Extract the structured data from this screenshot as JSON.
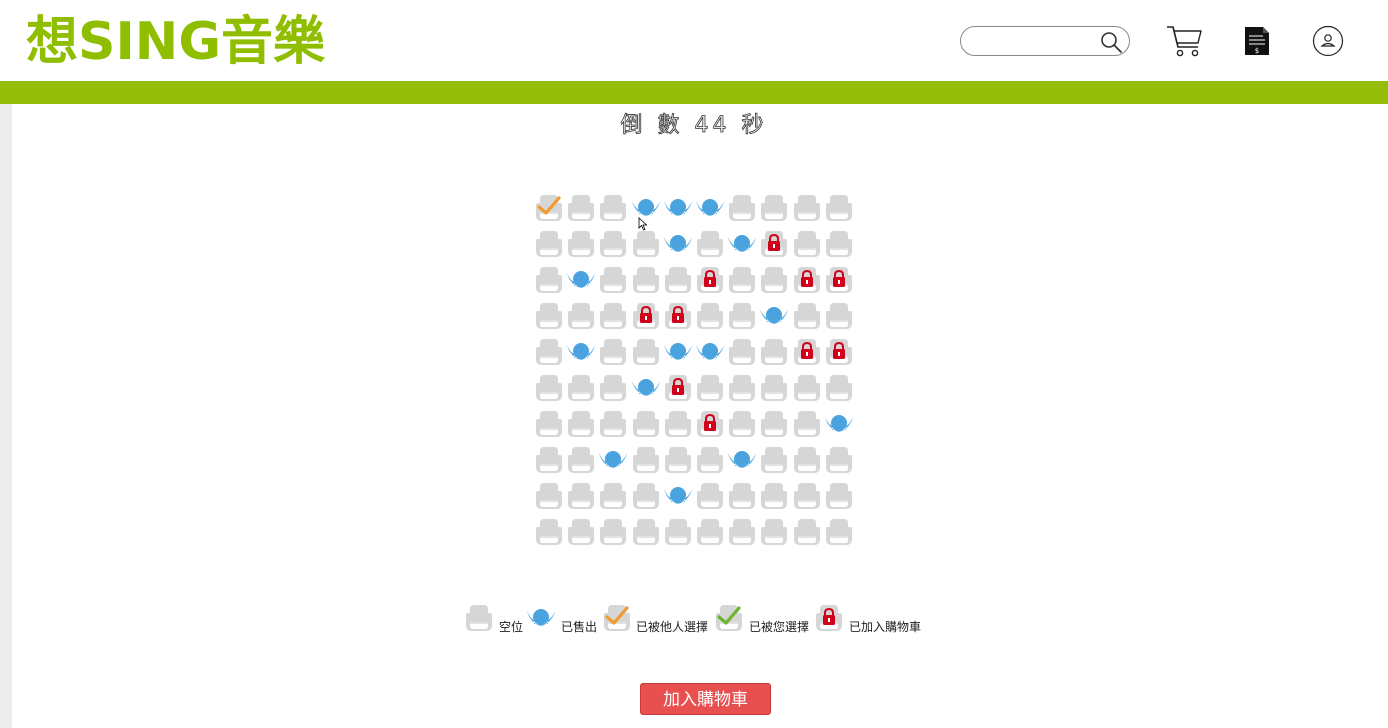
{
  "header": {
    "logo_text": "想SING音樂",
    "search": {
      "value": "",
      "placeholder": ""
    },
    "icons": [
      "search-icon",
      "cart-icon",
      "document-icon",
      "user-icon"
    ]
  },
  "countdown": {
    "text": "倒 數 44 秒"
  },
  "colors": {
    "brand_green": "#94be0a",
    "seat_empty": "#d6d6d6",
    "seat_sold": "#4aa3df",
    "seat_taken_check": "#f09a30",
    "seat_mine_check": "#6cb52d",
    "seat_in_cart_lock": "#d0021b",
    "button_red": "#e84f4f"
  },
  "seat_map": {
    "rows": 10,
    "cols": 10,
    "legend_keys": {
      "E": "empty",
      "S": "sold",
      "O": "selected-by-others",
      "M": "selected-by-you",
      "L": "in-cart"
    },
    "grid": [
      [
        "O",
        "E",
        "E",
        "S",
        "S",
        "S",
        "E",
        "E",
        "E",
        "E"
      ],
      [
        "E",
        "E",
        "E",
        "E",
        "S",
        "E",
        "S",
        "L",
        "E",
        "E"
      ],
      [
        "E",
        "S",
        "E",
        "E",
        "E",
        "L",
        "E",
        "E",
        "L",
        "L"
      ],
      [
        "E",
        "E",
        "E",
        "L",
        "L",
        "E",
        "E",
        "S",
        "E",
        "E"
      ],
      [
        "E",
        "S",
        "E",
        "E",
        "S",
        "S",
        "E",
        "E",
        "L",
        "L"
      ],
      [
        "E",
        "E",
        "E",
        "S",
        "L",
        "E",
        "E",
        "E",
        "E",
        "E"
      ],
      [
        "E",
        "E",
        "E",
        "E",
        "E",
        "L",
        "E",
        "E",
        "E",
        "S"
      ],
      [
        "E",
        "E",
        "S",
        "E",
        "E",
        "E",
        "S",
        "E",
        "E",
        "E"
      ],
      [
        "E",
        "E",
        "E",
        "E",
        "S",
        "E",
        "E",
        "E",
        "E",
        "E"
      ],
      [
        "E",
        "E",
        "E",
        "E",
        "E",
        "E",
        "E",
        "E",
        "E",
        "E"
      ]
    ]
  },
  "legend": [
    {
      "key": "E",
      "label": "空位"
    },
    {
      "key": "S",
      "label": "已售出"
    },
    {
      "key": "O",
      "label": "已被他人選擇"
    },
    {
      "key": "M",
      "label": "已被您選擇"
    },
    {
      "key": "L",
      "label": "已加入購物車"
    }
  ],
  "actions": {
    "add_to_cart_label": "加入購物車"
  }
}
